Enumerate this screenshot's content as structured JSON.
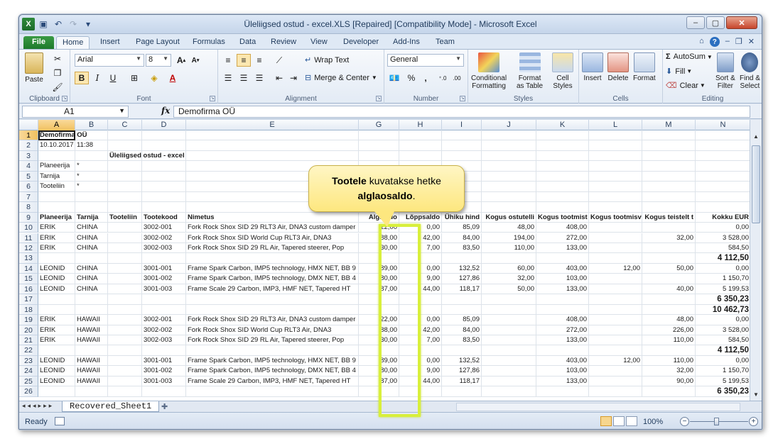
{
  "window": {
    "title": "Üleliigsed ostud - excel.XLS [Repaired]  [Compatibility Mode]  -  Microsoft Excel"
  },
  "tabs": [
    "File",
    "Home",
    "Insert",
    "Page Layout",
    "Formulas",
    "Data",
    "Review",
    "View",
    "Developer",
    "Add-Ins",
    "Team"
  ],
  "ribbon": {
    "clipboard": {
      "label": "Clipboard",
      "paste": "Paste"
    },
    "font": {
      "label": "Font",
      "name": "Arial",
      "size": "8",
      "bold": "B",
      "italic": "I",
      "underline": "U"
    },
    "alignment": {
      "label": "Alignment",
      "wrap": "Wrap Text",
      "merge": "Merge & Center"
    },
    "number": {
      "label": "Number",
      "format": "General",
      "percent": "%",
      "comma": ","
    },
    "styles": {
      "label": "Styles",
      "cond_1": "Conditional",
      "cond_2": "Formatting",
      "table_1": "Format",
      "table_2": "as Table",
      "cell_1": "Cell",
      "cell_2": "Styles"
    },
    "cells": {
      "label": "Cells",
      "insert": "Insert",
      "delete": "Delete",
      "format": "Format"
    },
    "editing": {
      "label": "Editing",
      "autosum": "AutoSum",
      "fill": "Fill",
      "clear": "Clear",
      "sort_1": "Sort &",
      "sort_2": "Filter",
      "find_1": "Find &",
      "find_2": "Select"
    }
  },
  "formula_bar": {
    "name_box": "A1",
    "fx": "fx",
    "content": "Demofirma OÜ"
  },
  "columns": [
    "A",
    "B",
    "C",
    "D",
    "E",
    "G",
    "H",
    "I",
    "J",
    "K",
    "L",
    "M",
    "N"
  ],
  "rows": [
    {
      "n": "1",
      "cells": {
        "A": "Demofirma OÜ"
      }
    },
    {
      "n": "2",
      "cells": {
        "A": "10.10.2017",
        "B": "11:38"
      }
    },
    {
      "n": "3",
      "cells": {
        "C": "Üleliigsed ostud - excel"
      }
    },
    {
      "n": "4",
      "cells": {
        "A": "Planeerija",
        "B": "*"
      }
    },
    {
      "n": "5",
      "cells": {
        "A": "Tarnija",
        "B": "*"
      }
    },
    {
      "n": "6",
      "cells": {
        "A": "Tooteliin",
        "B": "*"
      }
    },
    {
      "n": "7",
      "cells": {}
    },
    {
      "n": "8",
      "cells": {}
    },
    {
      "n": "9",
      "header": true,
      "cells": {
        "A": "Planeerija",
        "B": "Tarnija",
        "C": "Tooteliin",
        "D": "Tootekood",
        "E": "Nimetus",
        "G": "Algsaldo",
        "H": "Lõppsaldo",
        "I": "Ühiku hind",
        "J": "Kogus ostutelli",
        "K": "Kogus tootmist",
        "L": "Kogus tootmisv",
        "M": "Kogus teistelt t",
        "N": "Kokku EUR"
      }
    },
    {
      "n": "10",
      "cells": {
        "A": "ERIK",
        "B": "CHINA",
        "D": "3002-001",
        "E": "Fork Rock Shox SID 29 RLT3 Air, DNA3 custom damper",
        "G": "22,00",
        "H": "0,00",
        "I": "85,09",
        "J": "48,00",
        "K": "408,00",
        "N": "0,00"
      }
    },
    {
      "n": "11",
      "cells": {
        "A": "ERIK",
        "B": "CHINA",
        "D": "3002-002",
        "E": "Fork Rock Shox SID World Cup RLT3 Air, DNA3",
        "G": "88,00",
        "H": "42,00",
        "I": "84,00",
        "J": "194,00",
        "K": "272,00",
        "M": "32,00",
        "N": "3 528,00"
      }
    },
    {
      "n": "12",
      "cells": {
        "A": "ERIK",
        "B": "CHINA",
        "D": "3002-003",
        "E": "Fork Rock Shox SID 29 RL Air, Tapered steerer, Pop",
        "G": "30,00",
        "H": "7,00",
        "I": "83,50",
        "J": "110,00",
        "K": "133,00",
        "N": "584,50"
      }
    },
    {
      "n": "13",
      "total": true,
      "cells": {
        "N": "4 112,50"
      }
    },
    {
      "n": "14",
      "cells": {
        "A": "LEONID",
        "B": "CHINA",
        "D": "3001-001",
        "E": "Frame Spark Carbon, IMP5 technology, HMX NET, BB 9",
        "G": "89,00",
        "H": "0,00",
        "I": "132,52",
        "J": "60,00",
        "K": "403,00",
        "L": "12,00",
        "M": "50,00",
        "N": "0,00"
      }
    },
    {
      "n": "15",
      "cells": {
        "A": "LEONID",
        "B": "CHINA",
        "D": "3001-002",
        "E": "Frame Spark Carbon, IMP5 technology, DMX NET, BB 4",
        "G": "80,00",
        "H": "9,00",
        "I": "127,86",
        "J": "32,00",
        "K": "103,00",
        "N": "1 150,70"
      }
    },
    {
      "n": "16",
      "cells": {
        "A": "LEONID",
        "B": "CHINA",
        "D": "3001-003",
        "E": "Frame Scale 29 Carbon, IMP3, HMF NET, Tapered HT",
        "G": "87,00",
        "H": "44,00",
        "I": "118,17",
        "J": "50,00",
        "K": "133,00",
        "M": "40,00",
        "N": "5 199,53"
      }
    },
    {
      "n": "17",
      "total": true,
      "cells": {
        "N": "6 350,23"
      }
    },
    {
      "n": "18",
      "total": true,
      "cells": {
        "N": "10 462,73"
      }
    },
    {
      "n": "19",
      "cells": {
        "A": "ERIK",
        "B": "HAWAII",
        "D": "3002-001",
        "E": "Fork Rock Shox SID 29 RLT3 Air, DNA3 custom damper",
        "G": "22,00",
        "H": "0,00",
        "I": "85,09",
        "K": "408,00",
        "M": "48,00",
        "N": "0,00"
      }
    },
    {
      "n": "20",
      "cells": {
        "A": "ERIK",
        "B": "HAWAII",
        "D": "3002-002",
        "E": "Fork Rock Shox SID World Cup RLT3 Air, DNA3",
        "G": "88,00",
        "H": "42,00",
        "I": "84,00",
        "K": "272,00",
        "M": "226,00",
        "N": "3 528,00"
      }
    },
    {
      "n": "21",
      "cells": {
        "A": "ERIK",
        "B": "HAWAII",
        "D": "3002-003",
        "E": "Fork Rock Shox SID 29 RL Air, Tapered steerer, Pop",
        "G": "30,00",
        "H": "7,00",
        "I": "83,50",
        "K": "133,00",
        "M": "110,00",
        "N": "584,50"
      }
    },
    {
      "n": "22",
      "total": true,
      "cells": {
        "N": "4 112,50"
      }
    },
    {
      "n": "23",
      "cells": {
        "A": "LEONID",
        "B": "HAWAII",
        "D": "3001-001",
        "E": "Frame Spark Carbon, IMP5 technology, HMX NET, BB 9",
        "G": "89,00",
        "H": "0,00",
        "I": "132,52",
        "K": "403,00",
        "L": "12,00",
        "M": "110,00",
        "N": "0,00"
      }
    },
    {
      "n": "24",
      "cells": {
        "A": "LEONID",
        "B": "HAWAII",
        "D": "3001-002",
        "E": "Frame Spark Carbon, IMP5 technology, DMX NET, BB 4",
        "G": "80,00",
        "H": "9,00",
        "I": "127,86",
        "K": "103,00",
        "M": "32,00",
        "N": "1 150,70"
      }
    },
    {
      "n": "25",
      "cells": {
        "A": "LEONID",
        "B": "HAWAII",
        "D": "3001-003",
        "E": "Frame Scale 29 Carbon, IMP3, HMF NET, Tapered HT",
        "G": "87,00",
        "H": "44,00",
        "I": "118,17",
        "K": "133,00",
        "M": "90,00",
        "N": "5 199,53"
      }
    },
    {
      "n": "26",
      "total": true,
      "cells": {
        "N": "6 350,23"
      }
    }
  ],
  "sheet_tab": "Recovered_Sheet1",
  "status": {
    "ready": "Ready",
    "zoom": "100%"
  },
  "callout": {
    "bold": "Tootele",
    "text1": " kuvatakse hetke",
    "bold2": "alglaosaldo",
    "end": "."
  },
  "colors": {
    "highlight": "#d8ef3b",
    "callout": "#fde77f"
  }
}
